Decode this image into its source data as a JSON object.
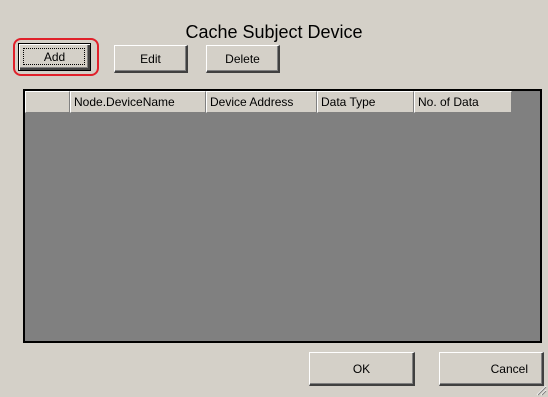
{
  "dialog": {
    "title": "Cache Subject Device"
  },
  "toolbar": {
    "add_label": "Add",
    "edit_label": "Edit",
    "delete_label": "Delete"
  },
  "grid": {
    "columns": [
      "",
      "Node.DeviceName",
      "Device Address",
      "Data Type",
      "No. of Data"
    ],
    "rows": []
  },
  "footer": {
    "ok_label": "OK",
    "cancel_label": "Cancel"
  },
  "colors": {
    "dialog_background": "#d4d0c8",
    "grid_background": "#808080",
    "highlight": "#e0202a"
  }
}
